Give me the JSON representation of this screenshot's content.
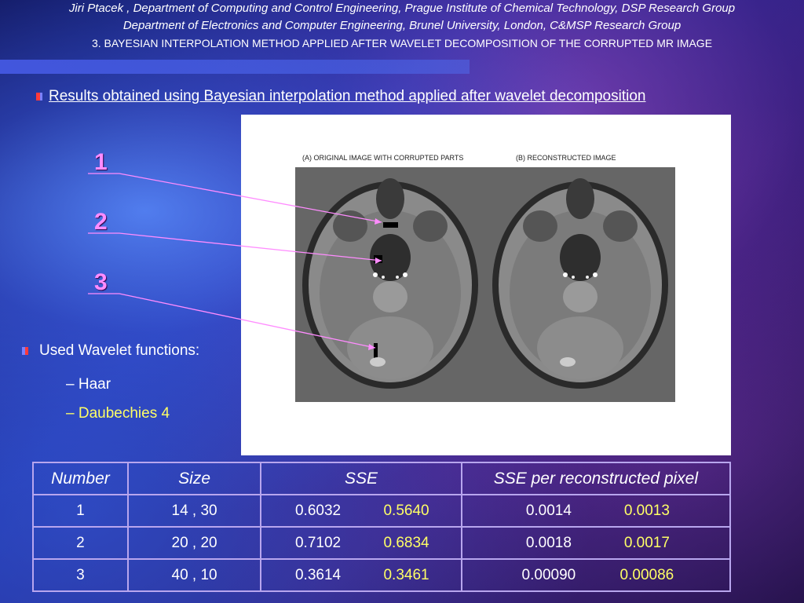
{
  "header": {
    "line1": "Jiri Ptacek ,  Department of Computing and Control Engineering, Prague Institute of Chemical Technology, DSP Research Group",
    "line2": "Department of Electronics and Computer Engineering, Brunel University, London, C&MSP Research Group",
    "line3": "3. BAYESIAN INTERPOLATION METHOD APPLIED AFTER WAVELET DECOMPOSITION OF THE CORRUPTED MR IMAGE"
  },
  "results_title": "Results obtained using Bayesian interpolation method applied after wavelet decomposition",
  "figure": {
    "caption_a": "(A) ORIGINAL IMAGE WITH CORRUPTED PARTS",
    "caption_b": "(B) RECONSTRUCTED IMAGE"
  },
  "markers": [
    "1",
    "2",
    "3"
  ],
  "wavelets": {
    "title": "Used Wavelet functions:",
    "items": [
      "– Haar",
      "– Daubechies 4"
    ]
  },
  "table": {
    "headers": [
      "Number",
      "Size",
      "SSE",
      "SSE per reconstructed pixel"
    ],
    "rows": [
      {
        "number": "1",
        "size": "14 , 30",
        "sse_a": "0.6032",
        "sse_b": "0.5640",
        "ssep_a": "0.0014",
        "ssep_b": "0.0013"
      },
      {
        "number": "2",
        "size": "20 , 20",
        "sse_a": "0.7102",
        "sse_b": "0.6834",
        "ssep_a": "0.0018",
        "ssep_b": "0.0017"
      },
      {
        "number": "3",
        "size": "40 , 10",
        "sse_a": "0.3614",
        "sse_b": "0.3461",
        "ssep_a": "0.00090",
        "ssep_b": "0.00086"
      }
    ]
  },
  "colors": {
    "highlight": "#ffff66",
    "marker": "#ff8cff",
    "table_border": "#b8a6ee"
  }
}
